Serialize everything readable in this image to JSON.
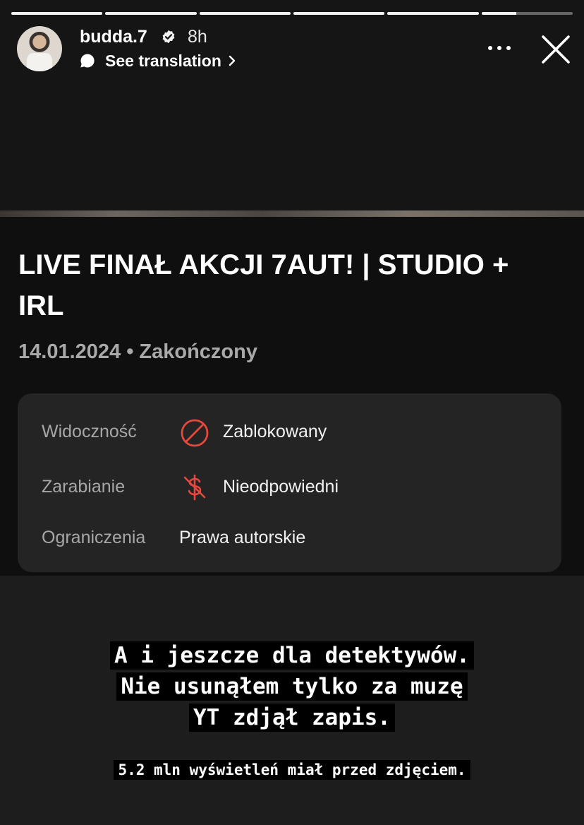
{
  "story": {
    "segments": [
      1,
      1,
      1,
      1,
      1,
      0.38
    ],
    "username": "budda.7",
    "time_ago": "8h",
    "translate_label": "See translation",
    "more_icon": "more-horizontal-icon",
    "close_icon": "close-icon"
  },
  "screenshot": {
    "title": "LIVE FINAŁ AKCJI 7AUT! | STUDIO + IRL",
    "meta": "14.01.2024 • Zakończony",
    "details": [
      {
        "label": "Widoczność",
        "icon": "blocked-icon",
        "value": "Zablokowany",
        "icon_color": "#e5483c"
      },
      {
        "label": "Zarabianie",
        "icon": "no-monetization-icon",
        "value": "Nieodpowiedni",
        "icon_color": "#e5483c"
      },
      {
        "label": "Ograniczenia",
        "value": "Prawa autorskie"
      }
    ]
  },
  "caption": {
    "lines": [
      "A i jeszcze dla detektywów.",
      "Nie usunąłem tylko za muzę",
      "YT zdjął zapis."
    ],
    "footnote": "5.2 mln wyświetleń miał przed zdjęciem."
  }
}
